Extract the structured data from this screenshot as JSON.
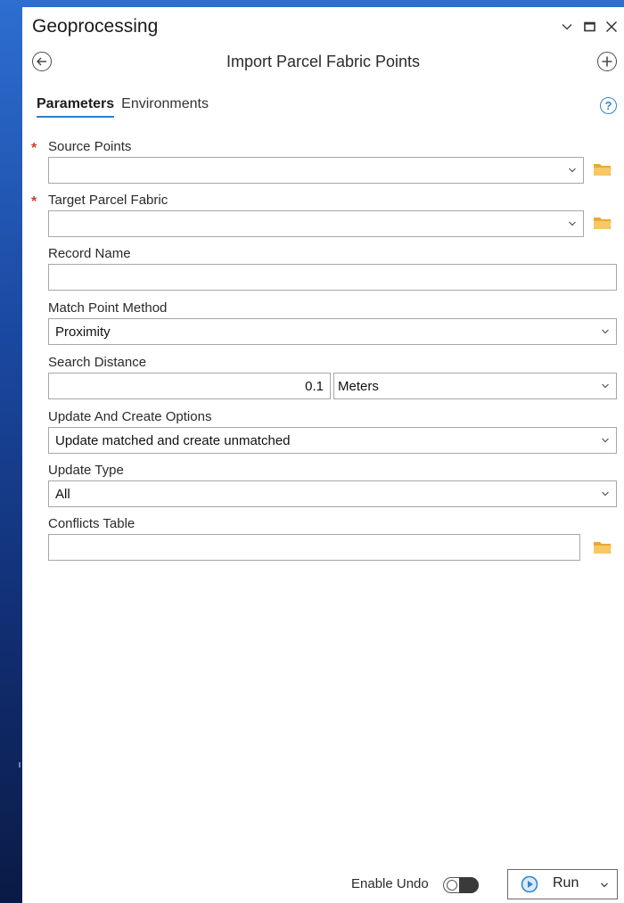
{
  "window": {
    "title": "Geoprocessing"
  },
  "tool": {
    "title": "Import Parcel Fabric Points"
  },
  "tabs": [
    {
      "label": "Parameters",
      "active": true
    },
    {
      "label": "Environments",
      "active": false
    }
  ],
  "params": {
    "source_points": {
      "label": "Source Points",
      "required": "*",
      "value": ""
    },
    "target_parcel_fabric": {
      "label": "Target Parcel Fabric",
      "required": "*",
      "value": ""
    },
    "record_name": {
      "label": "Record Name",
      "value": ""
    },
    "match_point_method": {
      "label": "Match Point Method",
      "value": "Proximity"
    },
    "search_distance": {
      "label": "Search Distance",
      "value": "0.1",
      "unit": "Meters"
    },
    "update_create_options": {
      "label": "Update And Create Options",
      "value": "Update matched and create unmatched"
    },
    "update_type": {
      "label": "Update Type",
      "value": "All"
    },
    "conflicts_table": {
      "label": "Conflicts Table",
      "value": ""
    }
  },
  "footer": {
    "enable_undo_label": "Enable Undo",
    "run_label": "Run"
  },
  "icons": {
    "back": "back-arrow-circle-icon",
    "add": "plus-circle-icon",
    "help": "help-icon",
    "folder": "folder-icon",
    "chevron": "chevron-down-icon",
    "run": "play-circle-icon"
  },
  "colors": {
    "accent": "#2c7fc9",
    "required": "#d23c2a",
    "folder": "#f2b84b"
  }
}
